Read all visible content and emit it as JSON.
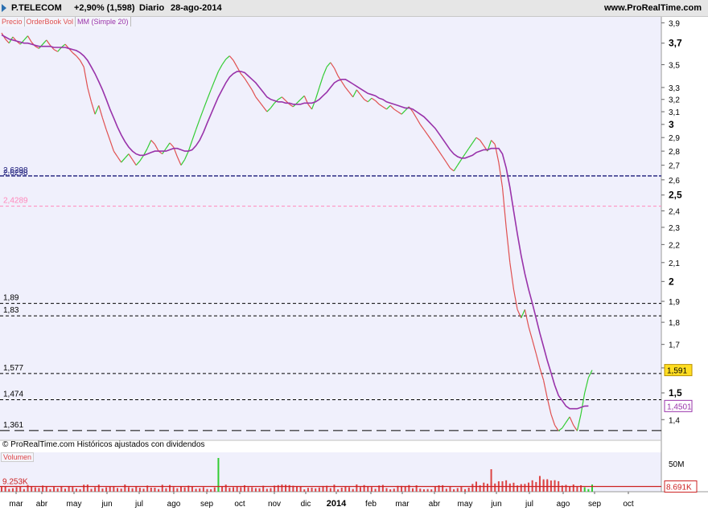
{
  "header": {
    "symbol": "P.TELECOM",
    "change": "+2,90% (1,598)",
    "period": "Diario",
    "date": "28-ago-2014",
    "site": "www.ProRealTime.com"
  },
  "legend": {
    "items": [
      "Precio",
      "OrderBook Vol",
      "MM (Simple 20)"
    ]
  },
  "footer_note": "© ProRealTime.com  Históricos ajustados con dividendos",
  "volume_label": "Volumen",
  "colors": {
    "price_up": "#33cc33",
    "price_down": "#e05050",
    "ma": "#9933aa",
    "vol_bar": "#dd4444",
    "pink_line": "#ff88bb",
    "background": "#f0f0fc",
    "current_label_bg": "#ffdd22"
  },
  "chart_data": [
    {
      "type": "line",
      "ylim": [
        1.33,
        3.96
      ],
      "yscale": "log",
      "yticks": [
        "1,4",
        "1,5",
        "1,6",
        "1,7",
        "1,8",
        "1,9",
        "2",
        "2,1",
        "2,2",
        "2,3",
        "2,4",
        "2,5",
        "2,6",
        "2,7",
        "2,8",
        "2,9",
        "3",
        "3,1",
        "3,2",
        "3,3",
        "3,5",
        "3,7",
        "3,9"
      ],
      "bold_yticks": [
        "1,5",
        "2",
        "2,5",
        "3",
        "3,7"
      ],
      "xticks": [
        "mar",
        "abr",
        "may",
        "jun",
        "jul",
        "ago",
        "sep",
        "oct",
        "nov",
        "dic",
        "2014",
        "feb",
        "mar",
        "abr",
        "may",
        "jun",
        "jul",
        "ago",
        "sep",
        "oct"
      ],
      "series": [
        {
          "name": "Precio",
          "values": [
            3.8,
            3.74,
            3.7,
            3.76,
            3.72,
            3.69,
            3.73,
            3.77,
            3.71,
            3.67,
            3.65,
            3.69,
            3.73,
            3.68,
            3.64,
            3.62,
            3.66,
            3.69,
            3.65,
            3.61,
            3.58,
            3.54,
            3.48,
            3.3,
            3.18,
            3.08,
            3.15,
            3.05,
            2.96,
            2.88,
            2.8,
            2.76,
            2.72,
            2.75,
            2.78,
            2.74,
            2.7,
            2.73,
            2.77,
            2.82,
            2.88,
            2.85,
            2.8,
            2.78,
            2.82,
            2.86,
            2.83,
            2.76,
            2.7,
            2.74,
            2.8,
            2.88,
            2.96,
            3.04,
            3.12,
            3.2,
            3.28,
            3.36,
            3.44,
            3.5,
            3.55,
            3.58,
            3.54,
            3.48,
            3.42,
            3.38,
            3.33,
            3.28,
            3.22,
            3.18,
            3.14,
            3.1,
            3.13,
            3.17,
            3.2,
            3.22,
            3.19,
            3.16,
            3.14,
            3.17,
            3.2,
            3.23,
            3.16,
            3.12,
            3.2,
            3.3,
            3.4,
            3.48,
            3.52,
            3.47,
            3.4,
            3.35,
            3.3,
            3.26,
            3.22,
            3.28,
            3.24,
            3.2,
            3.18,
            3.21,
            3.19,
            3.16,
            3.14,
            3.12,
            3.15,
            3.12,
            3.1,
            3.08,
            3.11,
            3.14,
            3.1,
            3.05,
            3.0,
            2.96,
            2.92,
            2.88,
            2.84,
            2.8,
            2.76,
            2.72,
            2.68,
            2.66,
            2.7,
            2.74,
            2.78,
            2.82,
            2.86,
            2.9,
            2.88,
            2.84,
            2.8,
            2.88,
            2.85,
            2.72,
            2.55,
            2.3,
            2.1,
            1.96,
            1.86,
            1.82,
            1.86,
            1.78,
            1.72,
            1.66,
            1.6,
            1.55,
            1.48,
            1.42,
            1.38,
            1.36,
            1.37,
            1.39,
            1.41,
            1.38,
            1.36,
            1.42,
            1.5,
            1.56,
            1.591
          ]
        },
        {
          "name": "MM (Simple 20)",
          "values": [
            3.78,
            3.76,
            3.74,
            3.73,
            3.72,
            3.71,
            3.7,
            3.7,
            3.69,
            3.68,
            3.67,
            3.67,
            3.67,
            3.67,
            3.66,
            3.66,
            3.66,
            3.66,
            3.65,
            3.64,
            3.63,
            3.61,
            3.58,
            3.54,
            3.48,
            3.42,
            3.35,
            3.28,
            3.2,
            3.12,
            3.05,
            2.98,
            2.92,
            2.87,
            2.83,
            2.8,
            2.78,
            2.77,
            2.77,
            2.78,
            2.79,
            2.8,
            2.8,
            2.8,
            2.8,
            2.81,
            2.82,
            2.82,
            2.81,
            2.8,
            2.8,
            2.81,
            2.84,
            2.88,
            2.94,
            3.01,
            3.08,
            3.15,
            3.22,
            3.28,
            3.34,
            3.39,
            3.42,
            3.44,
            3.44,
            3.43,
            3.4,
            3.37,
            3.34,
            3.3,
            3.26,
            3.22,
            3.2,
            3.19,
            3.18,
            3.18,
            3.17,
            3.17,
            3.16,
            3.16,
            3.16,
            3.17,
            3.17,
            3.17,
            3.18,
            3.2,
            3.23,
            3.26,
            3.3,
            3.34,
            3.36,
            3.37,
            3.37,
            3.35,
            3.33,
            3.31,
            3.29,
            3.27,
            3.25,
            3.24,
            3.23,
            3.21,
            3.2,
            3.18,
            3.17,
            3.16,
            3.15,
            3.14,
            3.13,
            3.13,
            3.12,
            3.1,
            3.08,
            3.06,
            3.03,
            3.0,
            2.97,
            2.93,
            2.89,
            2.85,
            2.81,
            2.78,
            2.76,
            2.75,
            2.75,
            2.76,
            2.77,
            2.79,
            2.8,
            2.81,
            2.81,
            2.82,
            2.82,
            2.82,
            2.78,
            2.68,
            2.55,
            2.4,
            2.26,
            2.14,
            2.04,
            1.96,
            1.89,
            1.82,
            1.75,
            1.69,
            1.63,
            1.58,
            1.53,
            1.49,
            1.47,
            1.45,
            1.44,
            1.44,
            1.44,
            1.445,
            1.45,
            1.4501
          ]
        }
      ],
      "horizontal_lines": [
        {
          "value": 2.6264,
          "label": "2,6298",
          "style": "solid-dashed",
          "color": "#1a1a7a"
        },
        {
          "value": 2.4289,
          "label": "2,4289",
          "style": "dashed",
          "color": "#ff88bb"
        },
        {
          "value": 1.89,
          "label": "1,89",
          "style": "dashed",
          "color": "#000000"
        },
        {
          "value": 1.83,
          "label": "1,83",
          "style": "dashed",
          "color": "#000000"
        },
        {
          "value": 1.577,
          "label": "1,577",
          "style": "dashed",
          "color": "#000000"
        },
        {
          "value": 1.474,
          "label": "1,474",
          "style": "dashed",
          "color": "#000000"
        },
        {
          "value": 1.361,
          "label": "1,361",
          "style": "longdash",
          "color": "#000000"
        }
      ],
      "current_labels": [
        {
          "value": 1.591,
          "label": "1,591",
          "series": "Precio"
        },
        {
          "value": 1.4501,
          "label": "1,4501",
          "series": "MM (Simple 20)"
        }
      ]
    },
    {
      "type": "bar",
      "title": "Volumen",
      "ylim": [
        0,
        70000000
      ],
      "yticks": [
        "50M"
      ],
      "reference_line": {
        "label": "9.253K",
        "value": 9253000
      },
      "current_label": "8.691K",
      "spikes": [
        {
          "index": 58,
          "value": 60000000
        },
        {
          "index": 131,
          "value": 40000000
        },
        {
          "index": 144,
          "value": 28000000
        },
        {
          "index": 145,
          "value": 22000000
        },
        {
          "index": 146,
          "value": 20000000
        }
      ]
    }
  ]
}
